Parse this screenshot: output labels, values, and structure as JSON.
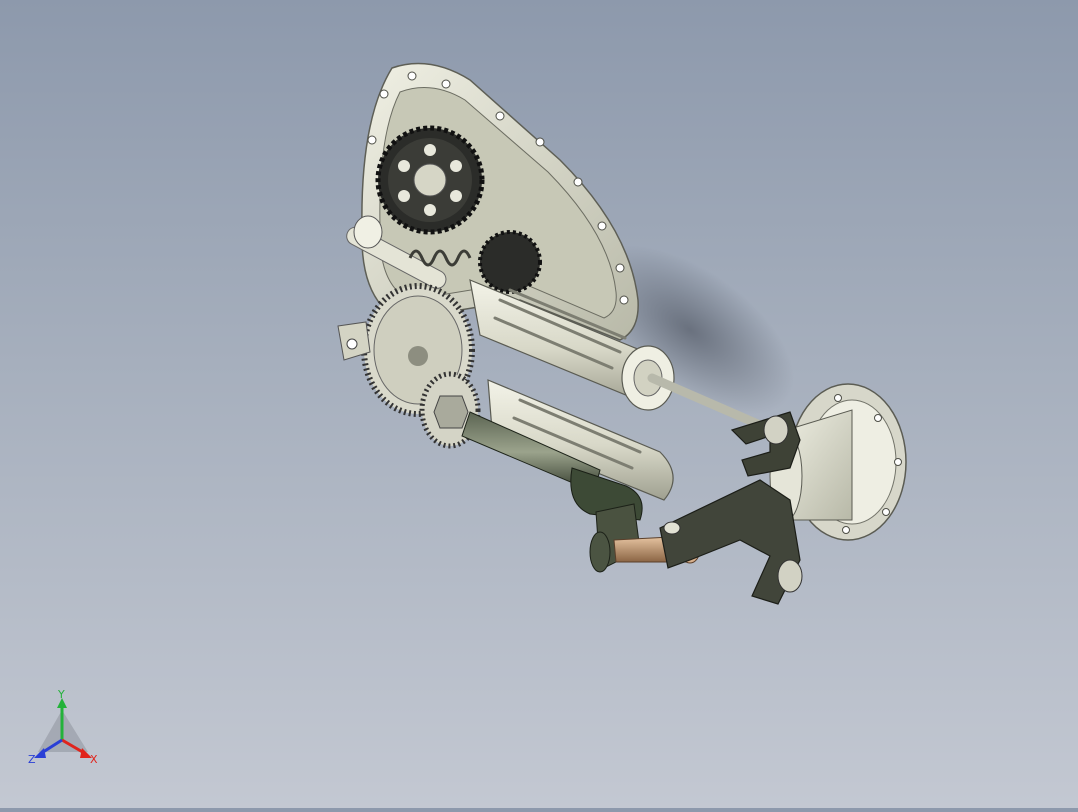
{
  "viewport": {
    "background_top": "#8d99ac",
    "background_bottom": "#c3c8d2",
    "model": {
      "casing_color": "#d8d8c6",
      "gear_color": "#2e2f2c",
      "sleeve_color": "#e0e0d2",
      "shaft_color": "#9ea091",
      "bracket_color": "#3f4238",
      "brass_color": "#c39a72"
    }
  },
  "triad": {
    "x_label": "X",
    "y_label": "Y",
    "z_label": "Z",
    "x_color": "#e0241c",
    "y_color": "#23b23a",
    "z_color": "#2a3fd6",
    "x_icon": "x-axis-arrow-icon",
    "y_icon": "y-axis-arrow-icon",
    "z_icon": "z-axis-arrow-icon"
  }
}
